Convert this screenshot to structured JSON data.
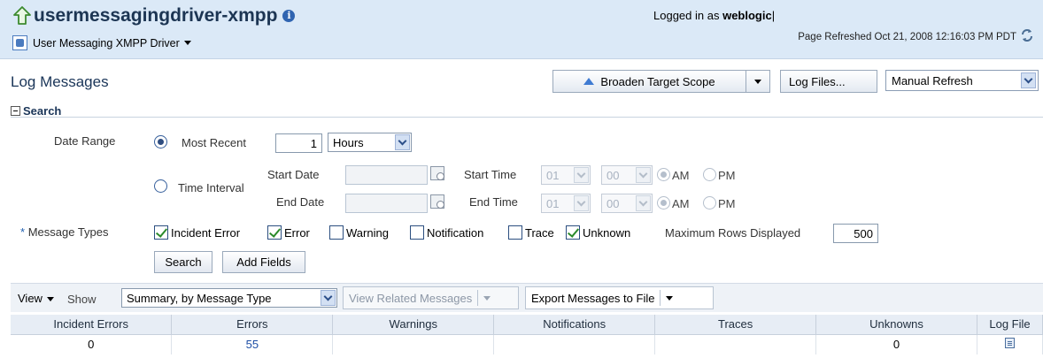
{
  "header": {
    "title": "usermessagingdriver-xmpp",
    "target_menu": "User Messaging XMPP Driver",
    "logged_in_label": "Logged in as",
    "logged_in_user": "weblogic",
    "refreshed": "Page Refreshed Oct 21, 2008 12:16:03 PM PDT"
  },
  "page": {
    "title": "Log Messages",
    "broaden_label": "Broaden Target Scope",
    "log_files_label": "Log Files...",
    "refresh_mode": "Manual Refresh"
  },
  "search": {
    "header": "Search",
    "date_range_label": "Date Range",
    "most_recent_label": "Most Recent",
    "most_recent_value": "1",
    "unit_value": "Hours",
    "time_interval_label": "Time Interval",
    "start_date_label": "Start Date",
    "end_date_label": "End Date",
    "start_time_label": "Start Time",
    "end_time_label": "End Time",
    "start_hour": "01",
    "start_min": "00",
    "end_hour": "01",
    "end_min": "00",
    "am": "AM",
    "pm": "PM",
    "required_mark": "*",
    "message_types_label": "Message Types",
    "types": [
      {
        "label": "Incident Error",
        "checked": true
      },
      {
        "label": "Error",
        "checked": true
      },
      {
        "label": "Warning",
        "checked": false
      },
      {
        "label": "Notification",
        "checked": false
      },
      {
        "label": "Trace",
        "checked": false
      },
      {
        "label": "Unknown",
        "checked": true
      }
    ],
    "max_rows_label": "Maximum Rows Displayed",
    "max_rows_value": "500",
    "search_button": "Search",
    "add_fields_button": "Add Fields"
  },
  "results": {
    "view_label": "View",
    "show_label": "Show",
    "show_value": "Summary, by Message Type",
    "related_label": "View Related Messages",
    "export_label": "Export Messages to File",
    "columns": [
      "Incident Errors",
      "Errors",
      "Warnings",
      "Notifications",
      "Traces",
      "Unknowns",
      "Log File"
    ],
    "row": [
      "0",
      "55",
      "",
      "",
      "",
      "0",
      ""
    ]
  }
}
